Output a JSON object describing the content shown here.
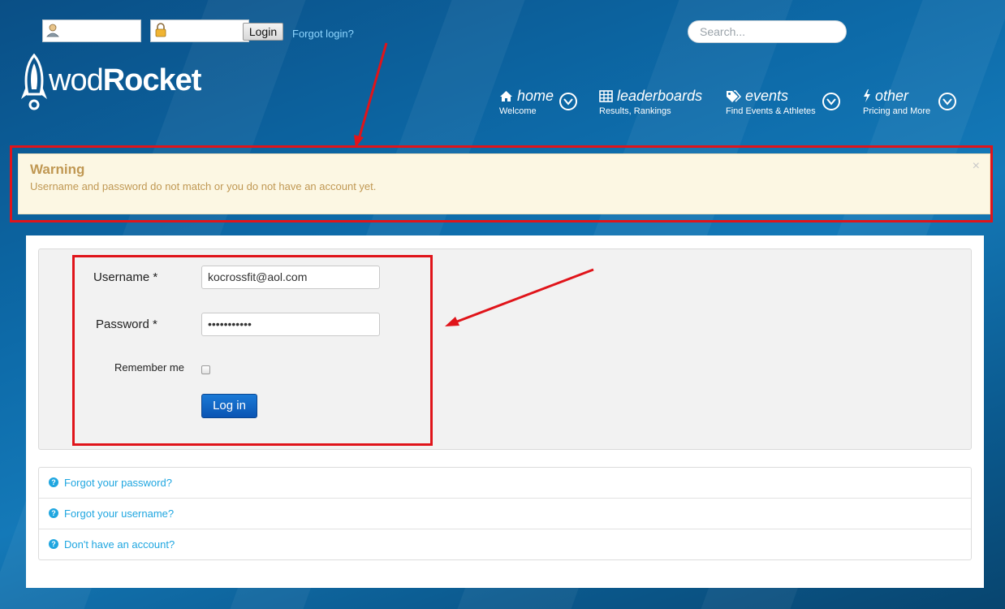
{
  "header": {
    "username_value": "",
    "password_value": "",
    "login_button": "Login",
    "forgot_login": "Forgot login?",
    "search_placeholder": "Search..."
  },
  "logo": {
    "part1": "wod",
    "part2": "Rocket"
  },
  "nav": [
    {
      "title": "home",
      "subtitle": "Welcome",
      "icon": "home-icon"
    },
    {
      "title": "leaderboards",
      "subtitle": "Results, Rankings",
      "icon": "table-icon"
    },
    {
      "title": "events",
      "subtitle": "Find Events & Athletes",
      "icon": "tags-icon"
    },
    {
      "title": "other",
      "subtitle": "Pricing and More",
      "icon": "bolt-icon"
    }
  ],
  "warning": {
    "title": "Warning",
    "message": "Username and password do not match or you do not have an account yet.",
    "close": "×"
  },
  "form": {
    "username_label": "Username *",
    "username_value": "kocrossfit@aol.com",
    "password_label": "Password *",
    "password_value": "•••••••••••",
    "remember_label": "Remember me",
    "remember_checked": false,
    "submit_label": "Log in"
  },
  "help_links": [
    {
      "label": "Forgot your password?"
    },
    {
      "label": "Forgot your username?"
    },
    {
      "label": "Don't have an account?"
    }
  ],
  "colors": {
    "annotation": "#e0141a",
    "link": "#1fa6e0",
    "warning_text": "#c09853",
    "warning_bg": "#fcf7e3",
    "button": "#0a54b3"
  }
}
